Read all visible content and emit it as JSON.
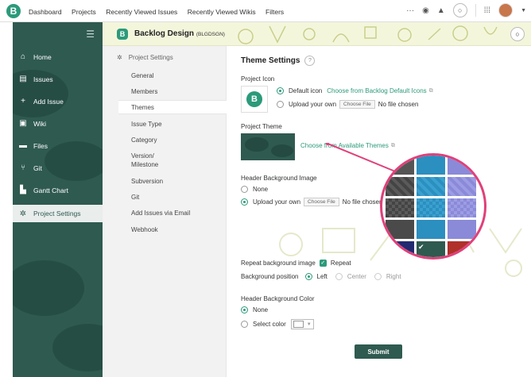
{
  "topnav": {
    "items": [
      "Dashboard",
      "Projects",
      "Recently Viewed Issues",
      "Recently Viewed Wikis",
      "Filters"
    ],
    "more": "···"
  },
  "sidebar": {
    "items": [
      {
        "label": "Home",
        "icon": "home-icon"
      },
      {
        "label": "Issues",
        "icon": "list-icon"
      },
      {
        "label": "Add Issue",
        "icon": "plus-icon"
      },
      {
        "label": "Wiki",
        "icon": "wiki-icon"
      },
      {
        "label": "Files",
        "icon": "folder-icon"
      },
      {
        "label": "Git",
        "icon": "git-icon"
      },
      {
        "label": "Gantt Chart",
        "icon": "gantt-icon"
      },
      {
        "label": "Project Settings",
        "icon": "gear-icon"
      }
    ]
  },
  "project": {
    "name": "Backlog Design",
    "key": "(BLGDSGN)"
  },
  "submenu": {
    "heading": "Project Settings",
    "items": [
      "General",
      "Members",
      "Themes",
      "Issue Type",
      "Category",
      "Version/",
      "Milestone",
      "Subversion",
      "Git",
      "Add Issues via Email",
      "Webhook"
    ]
  },
  "theme": {
    "title": "Theme Settings",
    "help": "?",
    "project_icon_label": "Project Icon",
    "default_icon": "Default icon",
    "choose_default_icons": "Choose from Backlog Default Icons",
    "upload_own": "Upload your own",
    "choose_file": "Choose File",
    "no_file": "No file chosen",
    "project_theme_label": "Project Theme",
    "choose_themes": "Choose from Available Themes",
    "header_bg_image_label": "Header Background Image",
    "none": "None",
    "repeat_label": "Repeat background image",
    "repeat": "Repeat",
    "bg_position_label": "Background position",
    "left": "Left",
    "center": "Center",
    "right": "Right",
    "header_bg_color_label": "Header Background Color",
    "select_color": "Select color",
    "submit": "Submit"
  },
  "colors": {
    "accent": "#2c9a7a",
    "sidebar": "#2f5a50",
    "magnifier_border": "#e0407a"
  }
}
